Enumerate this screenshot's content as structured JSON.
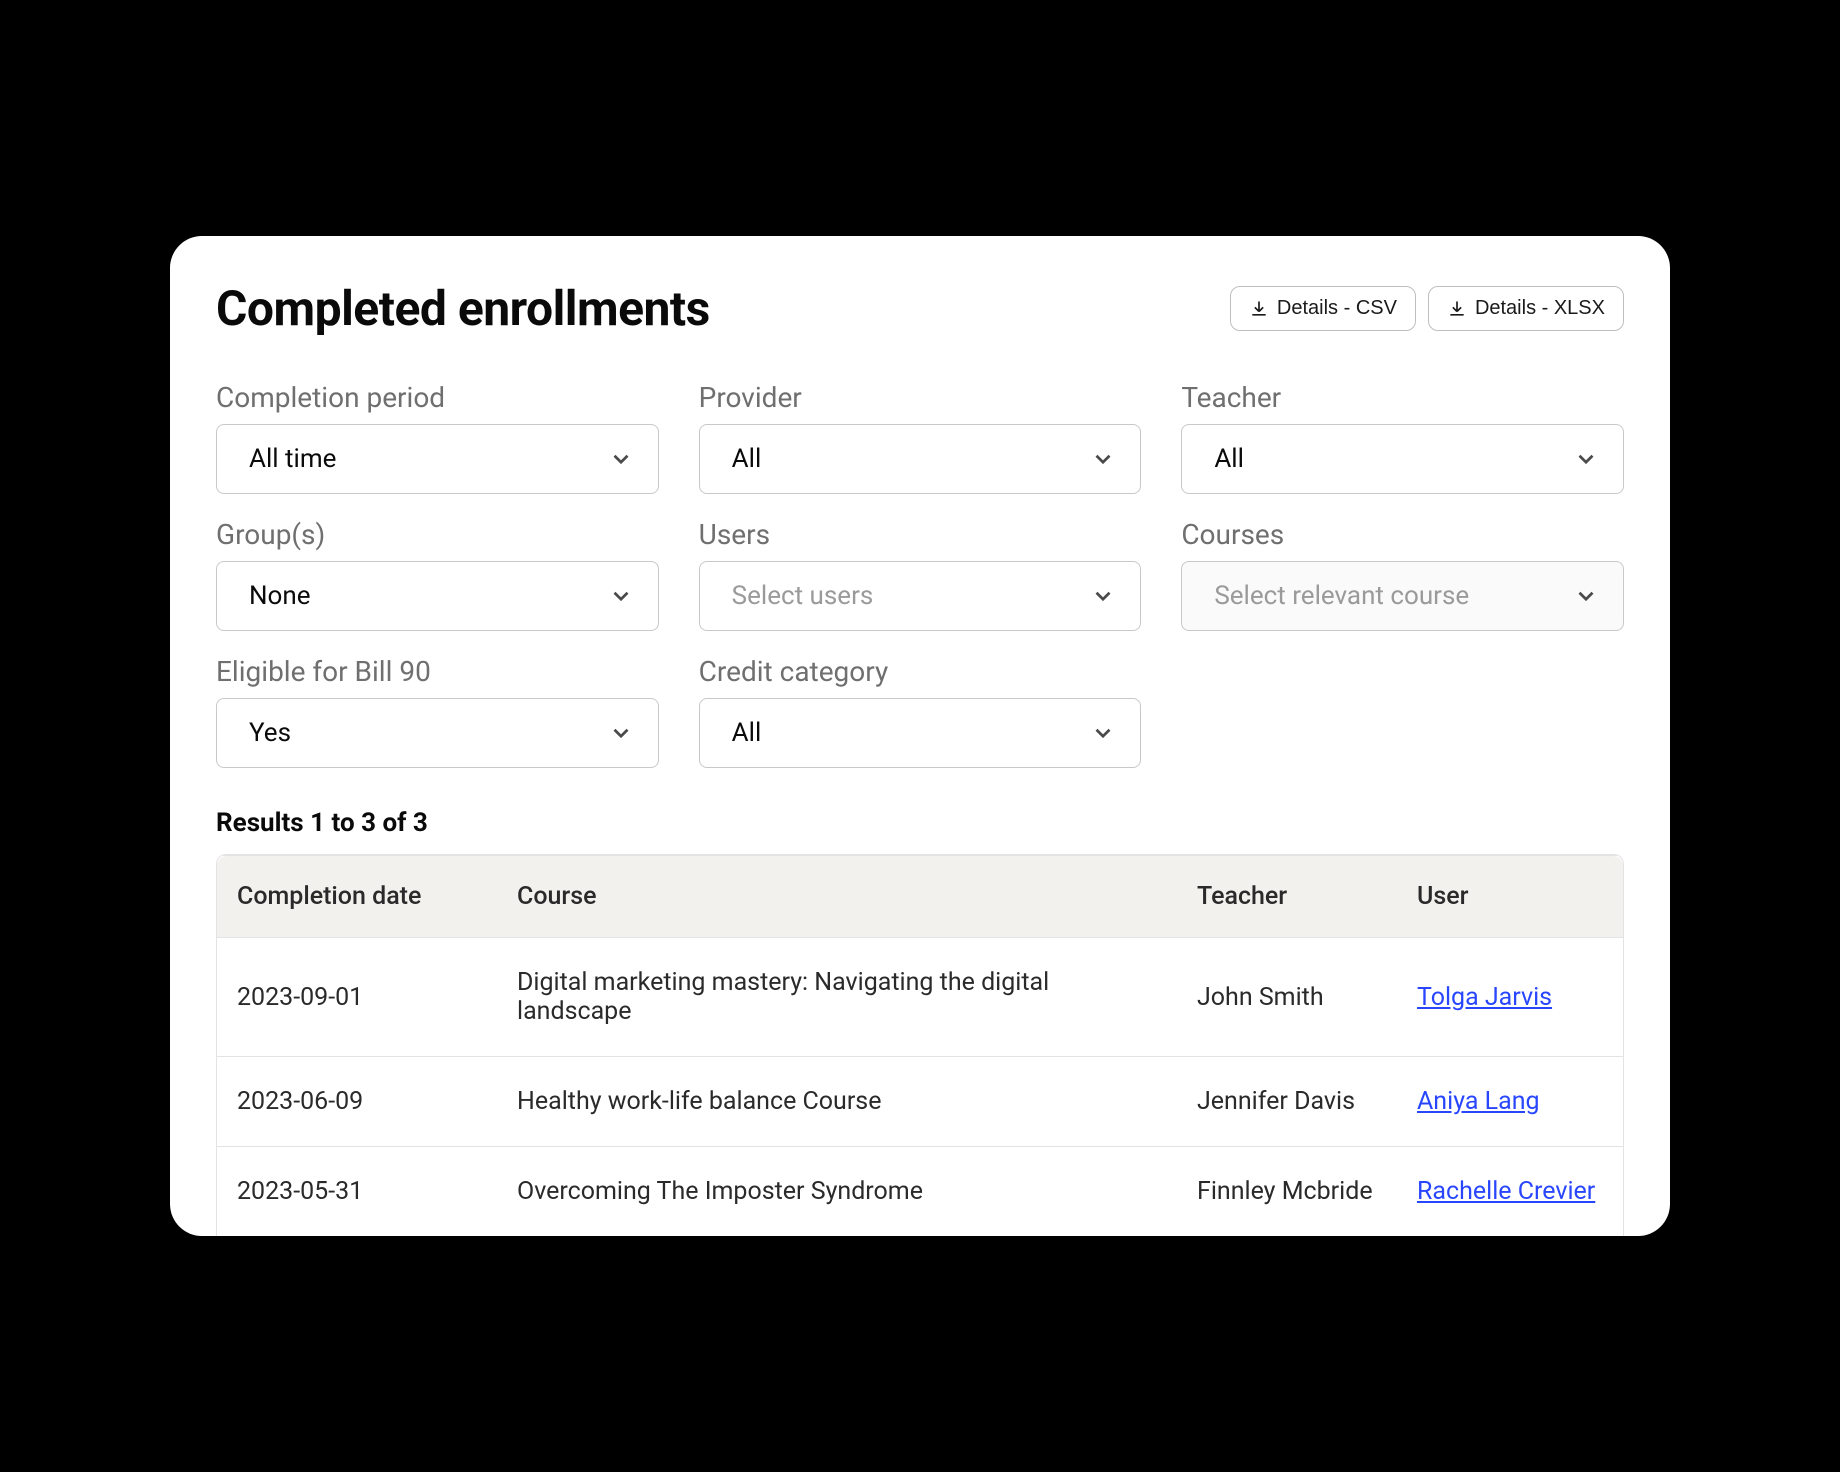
{
  "title": "Completed enrollments",
  "export": {
    "csv_label": "Details - CSV",
    "xlsx_label": "Details - XLSX"
  },
  "filters": {
    "completion_period": {
      "label": "Completion period",
      "value": "All time"
    },
    "provider": {
      "label": "Provider",
      "value": "All"
    },
    "teacher": {
      "label": "Teacher",
      "value": "All"
    },
    "groups": {
      "label": "Group(s)",
      "value": "None"
    },
    "users": {
      "label": "Users",
      "placeholder": "Select users"
    },
    "courses": {
      "label": "Courses",
      "placeholder": "Select relevant course"
    },
    "bill90": {
      "label": "Eligible for Bill 90",
      "value": "Yes"
    },
    "credit_category": {
      "label": "Credit category",
      "value": "All"
    }
  },
  "results_label": "Results 1 to 3 of 3",
  "table": {
    "headers": {
      "date": "Completion date",
      "course": "Course",
      "teacher": "Teacher",
      "user": "User"
    },
    "rows": [
      {
        "date": "2023-09-01",
        "course": "Digital marketing mastery: Navigating the digital landscape",
        "teacher": "John Smith",
        "user": "Tolga Jarvis"
      },
      {
        "date": "2023-06-09",
        "course": "Healthy work-life balance Course",
        "teacher": "Jennifer Davis",
        "user": "Aniya Lang"
      },
      {
        "date": "2023-05-31",
        "course": "Overcoming The Imposter Syndrome",
        "teacher": "Finnley Mcbride",
        "user": "Rachelle Crevier"
      }
    ]
  }
}
